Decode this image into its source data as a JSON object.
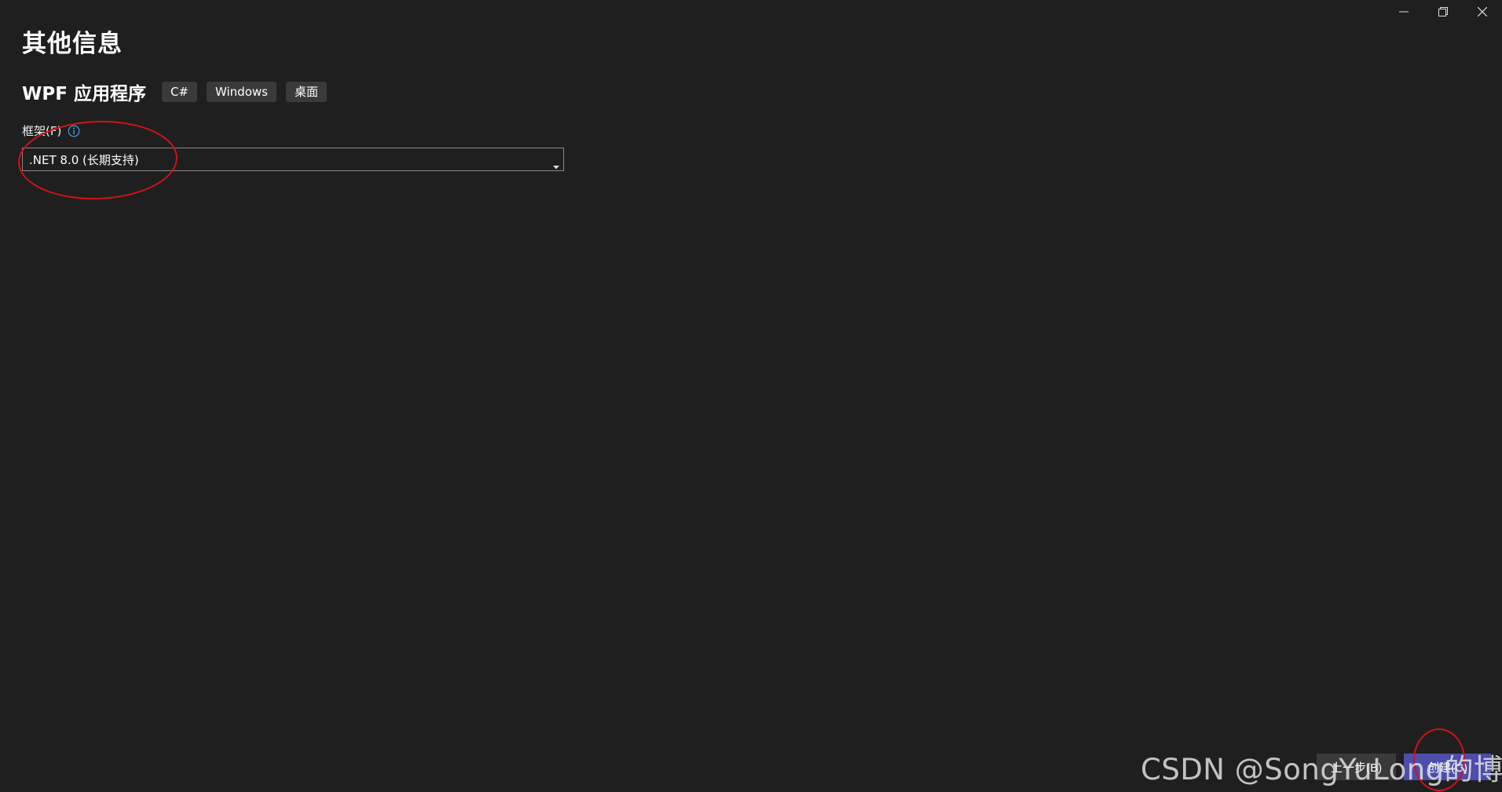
{
  "window_controls": {
    "minimize_icon": "minimize-icon",
    "restore_icon": "restore-icon",
    "close_icon": "close-icon"
  },
  "page_title": "其他信息",
  "template": {
    "name": "WPF 应用程序",
    "tags": [
      "C#",
      "Windows",
      "桌面"
    ]
  },
  "framework": {
    "label": "框架(F)",
    "info_icon": "info-icon",
    "selected": ".NET 8.0 (长期支持)"
  },
  "footer": {
    "back_label": "上一步(B)",
    "create_label": "创建(C)"
  },
  "watermark": "CSDN @SongYuLong的博客",
  "colors": {
    "background": "#1f1f1f",
    "primary_button": "#4d4dab",
    "annotation": "#d3121a",
    "info": "#3aa0e8"
  }
}
